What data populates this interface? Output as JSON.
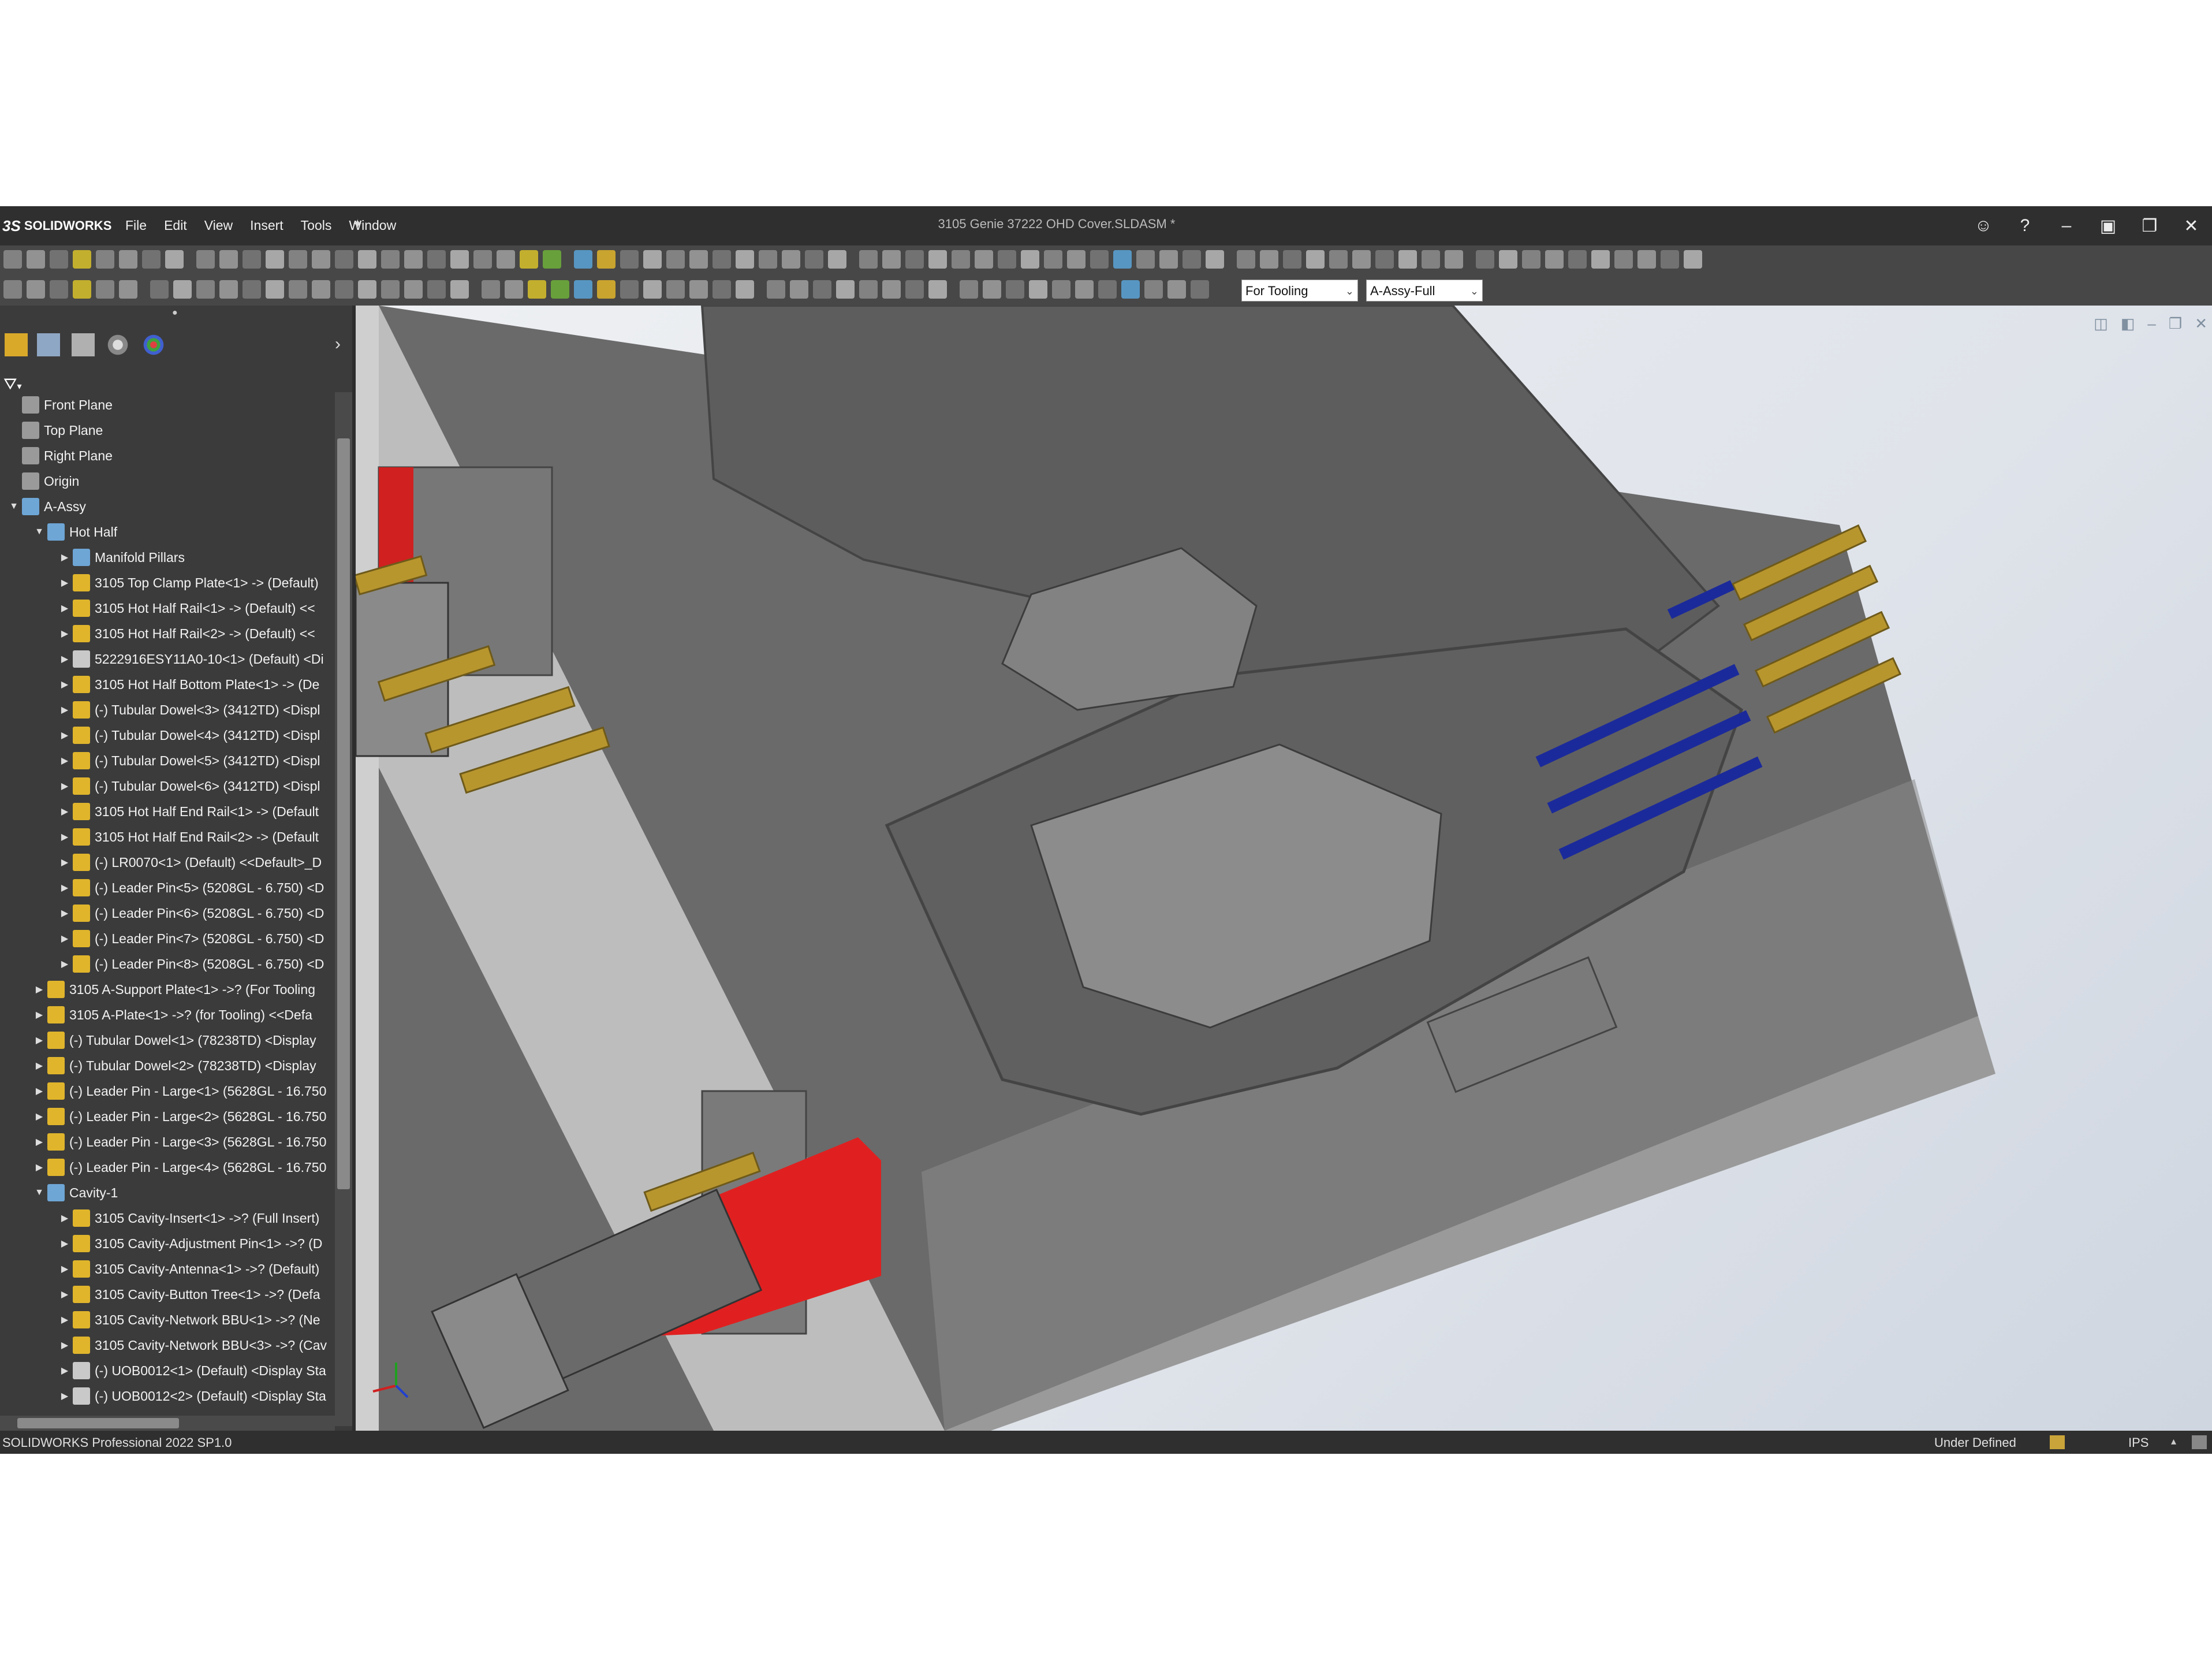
{
  "app": {
    "brand": "SOLIDWORKS",
    "document_title": "3105 Genie 37222 OHD Cover.SLDASM *"
  },
  "menu": [
    "File",
    "Edit",
    "View",
    "Insert",
    "Tools",
    "Window"
  ],
  "window_controls": [
    "user-icon",
    "help-icon",
    "minimize",
    "restore-window",
    "maximize",
    "close"
  ],
  "toolbar": {
    "config_combo": "For Tooling",
    "display_state_combo": "A-Assy-Full"
  },
  "tree": [
    {
      "indent": 0,
      "expand": "",
      "icon": "plane",
      "label": "Front Plane"
    },
    {
      "indent": 0,
      "expand": "",
      "icon": "plane",
      "label": "Top Plane"
    },
    {
      "indent": 0,
      "expand": "",
      "icon": "plane",
      "label": "Right Plane"
    },
    {
      "indent": 0,
      "expand": "",
      "icon": "origin",
      "label": "Origin"
    },
    {
      "indent": 0,
      "expand": "▼",
      "icon": "assembly-folder",
      "label": "A-Assy"
    },
    {
      "indent": 1,
      "expand": "▼",
      "icon": "subassembly",
      "label": "Hot Half"
    },
    {
      "indent": 2,
      "expand": "▶",
      "icon": "folder",
      "label": "Manifold Pillars"
    },
    {
      "indent": 2,
      "expand": "▶",
      "icon": "part",
      "label": "3105 Top Clamp Plate<1> -> (Default)"
    },
    {
      "indent": 2,
      "expand": "▶",
      "icon": "part",
      "label": "3105 Hot Half Rail<1> -> (Default) <<"
    },
    {
      "indent": 2,
      "expand": "▶",
      "icon": "part",
      "label": "3105 Hot Half Rail<2> -> (Default) <<"
    },
    {
      "indent": 2,
      "expand": "▶",
      "icon": "part-blue",
      "label": "5222916ESY11A0-10<1> (Default) <Di"
    },
    {
      "indent": 2,
      "expand": "▶",
      "icon": "part",
      "label": "3105 Hot Half Bottom Plate<1> -> (De"
    },
    {
      "indent": 2,
      "expand": "▶",
      "icon": "part",
      "label": "(-) Tubular Dowel<3> (3412TD) <Displ"
    },
    {
      "indent": 2,
      "expand": "▶",
      "icon": "part",
      "label": "(-) Tubular Dowel<4> (3412TD) <Displ"
    },
    {
      "indent": 2,
      "expand": "▶",
      "icon": "part",
      "label": "(-) Tubular Dowel<5> (3412TD) <Displ"
    },
    {
      "indent": 2,
      "expand": "▶",
      "icon": "part",
      "label": "(-) Tubular Dowel<6> (3412TD) <Displ"
    },
    {
      "indent": 2,
      "expand": "▶",
      "icon": "part",
      "label": "3105 Hot Half End Rail<1> -> (Default"
    },
    {
      "indent": 2,
      "expand": "▶",
      "icon": "part",
      "label": "3105 Hot Half End Rail<2> -> (Default"
    },
    {
      "indent": 2,
      "expand": "▶",
      "icon": "part",
      "label": "(-) LR0070<1> (Default) <<Default>_D"
    },
    {
      "indent": 2,
      "expand": "▶",
      "icon": "part",
      "label": "(-) Leader Pin<5> (5208GL - 6.750) <D"
    },
    {
      "indent": 2,
      "expand": "▶",
      "icon": "part",
      "label": "(-) Leader Pin<6> (5208GL - 6.750) <D"
    },
    {
      "indent": 2,
      "expand": "▶",
      "icon": "part",
      "label": "(-) Leader Pin<7> (5208GL - 6.750) <D"
    },
    {
      "indent": 2,
      "expand": "▶",
      "icon": "part",
      "label": "(-) Leader Pin<8> (5208GL - 6.750) <D"
    },
    {
      "indent": 1,
      "expand": "▶",
      "icon": "part",
      "label": "3105 A-Support Plate<1> ->? (For Tooling"
    },
    {
      "indent": 1,
      "expand": "▶",
      "icon": "part",
      "label": "3105 A-Plate<1> ->? (for Tooling) <<Defa"
    },
    {
      "indent": 1,
      "expand": "▶",
      "icon": "part",
      "label": "(-) Tubular Dowel<1> (78238TD) <Display"
    },
    {
      "indent": 1,
      "expand": "▶",
      "icon": "part",
      "label": "(-) Tubular Dowel<2> (78238TD) <Display"
    },
    {
      "indent": 1,
      "expand": "▶",
      "icon": "part",
      "label": "(-) Leader Pin - Large<1> (5628GL - 16.750"
    },
    {
      "indent": 1,
      "expand": "▶",
      "icon": "part",
      "label": "(-) Leader Pin - Large<2> (5628GL - 16.750"
    },
    {
      "indent": 1,
      "expand": "▶",
      "icon": "part",
      "label": "(-) Leader Pin - Large<3> (5628GL - 16.750"
    },
    {
      "indent": 1,
      "expand": "▶",
      "icon": "part",
      "label": "(-) Leader Pin - Large<4> (5628GL - 16.750"
    },
    {
      "indent": 1,
      "expand": "▼",
      "icon": "subassembly",
      "label": "Cavity-1"
    },
    {
      "indent": 2,
      "expand": "▶",
      "icon": "part",
      "label": "3105 Cavity-Insert<1> ->? (Full Insert)"
    },
    {
      "indent": 2,
      "expand": "▶",
      "icon": "part",
      "label": "3105 Cavity-Adjustment Pin<1> ->? (D"
    },
    {
      "indent": 2,
      "expand": "▶",
      "icon": "part",
      "label": "3105 Cavity-Antenna<1> ->? (Default)"
    },
    {
      "indent": 2,
      "expand": "▶",
      "icon": "part",
      "label": "3105 Cavity-Button Tree<1> ->? (Defa"
    },
    {
      "indent": 2,
      "expand": "▶",
      "icon": "part",
      "label": "3105 Cavity-Network BBU<1> ->? (Ne"
    },
    {
      "indent": 2,
      "expand": "▶",
      "icon": "part",
      "label": "3105 Cavity-Network BBU<3> ->? (Cav"
    },
    {
      "indent": 2,
      "expand": "▶",
      "icon": "part-blue",
      "label": "(-) UOB0012<1> (Default) <Display Sta"
    },
    {
      "indent": 2,
      "expand": "▶",
      "icon": "part-blue",
      "label": "(-) UOB0012<2> (Default) <Display Sta"
    }
  ],
  "status": {
    "product": "SOLIDWORKS Professional 2022 SP1.0",
    "state": "Under Defined",
    "units": "IPS"
  },
  "colors": {
    "part_gray": "#6e6e6e",
    "section_red": "#e02020",
    "pin_gold": "#b8962e",
    "pin_blue": "#1b2a9a"
  }
}
